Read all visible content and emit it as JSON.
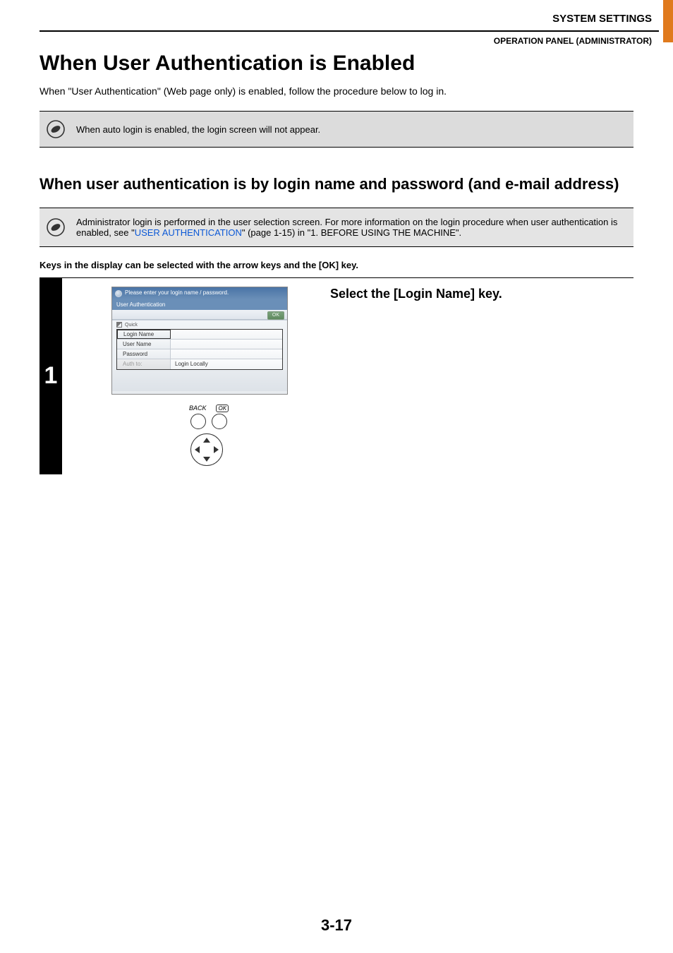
{
  "header": {
    "system_settings": "SYSTEM SETTINGS",
    "operation_panel": "OPERATION PANEL (ADMINISTRATOR)"
  },
  "title": "When User Authentication is Enabled",
  "intro": "When \"User Authentication\" (Web page only) is enabled, follow the procedure below to log in.",
  "note1": "When auto login is enabled, the login screen will not appear.",
  "sub_title": "When user authentication is by login name and password (and e-mail address)",
  "note2_pre": "Administrator login is performed in the user selection screen. For more information on the login procedure when user authentication is enabled, see \"",
  "note2_link": "USER AUTHENTICATION",
  "note2_post": "\" (page 1-15) in \"1. BEFORE USING THE MACHINE\".",
  "keys_text": "Keys in the display can be selected with the arrow keys and the [OK] key.",
  "step": {
    "number": "1",
    "instruction": "Select the [Login Name] key.",
    "screen": {
      "prompt": "Please enter your login name / password.",
      "panel_title": "User Authentication",
      "ok_btn": "OK",
      "quick": "Quick",
      "login_name_label": "Login Name",
      "user_name_label": "User Name",
      "password_label": "Password",
      "auth_to_label": "Auth to:",
      "auth_to_value": "Login Locally"
    },
    "controls": {
      "back": "BACK",
      "ok": "OK"
    }
  },
  "page_number": "3-17"
}
